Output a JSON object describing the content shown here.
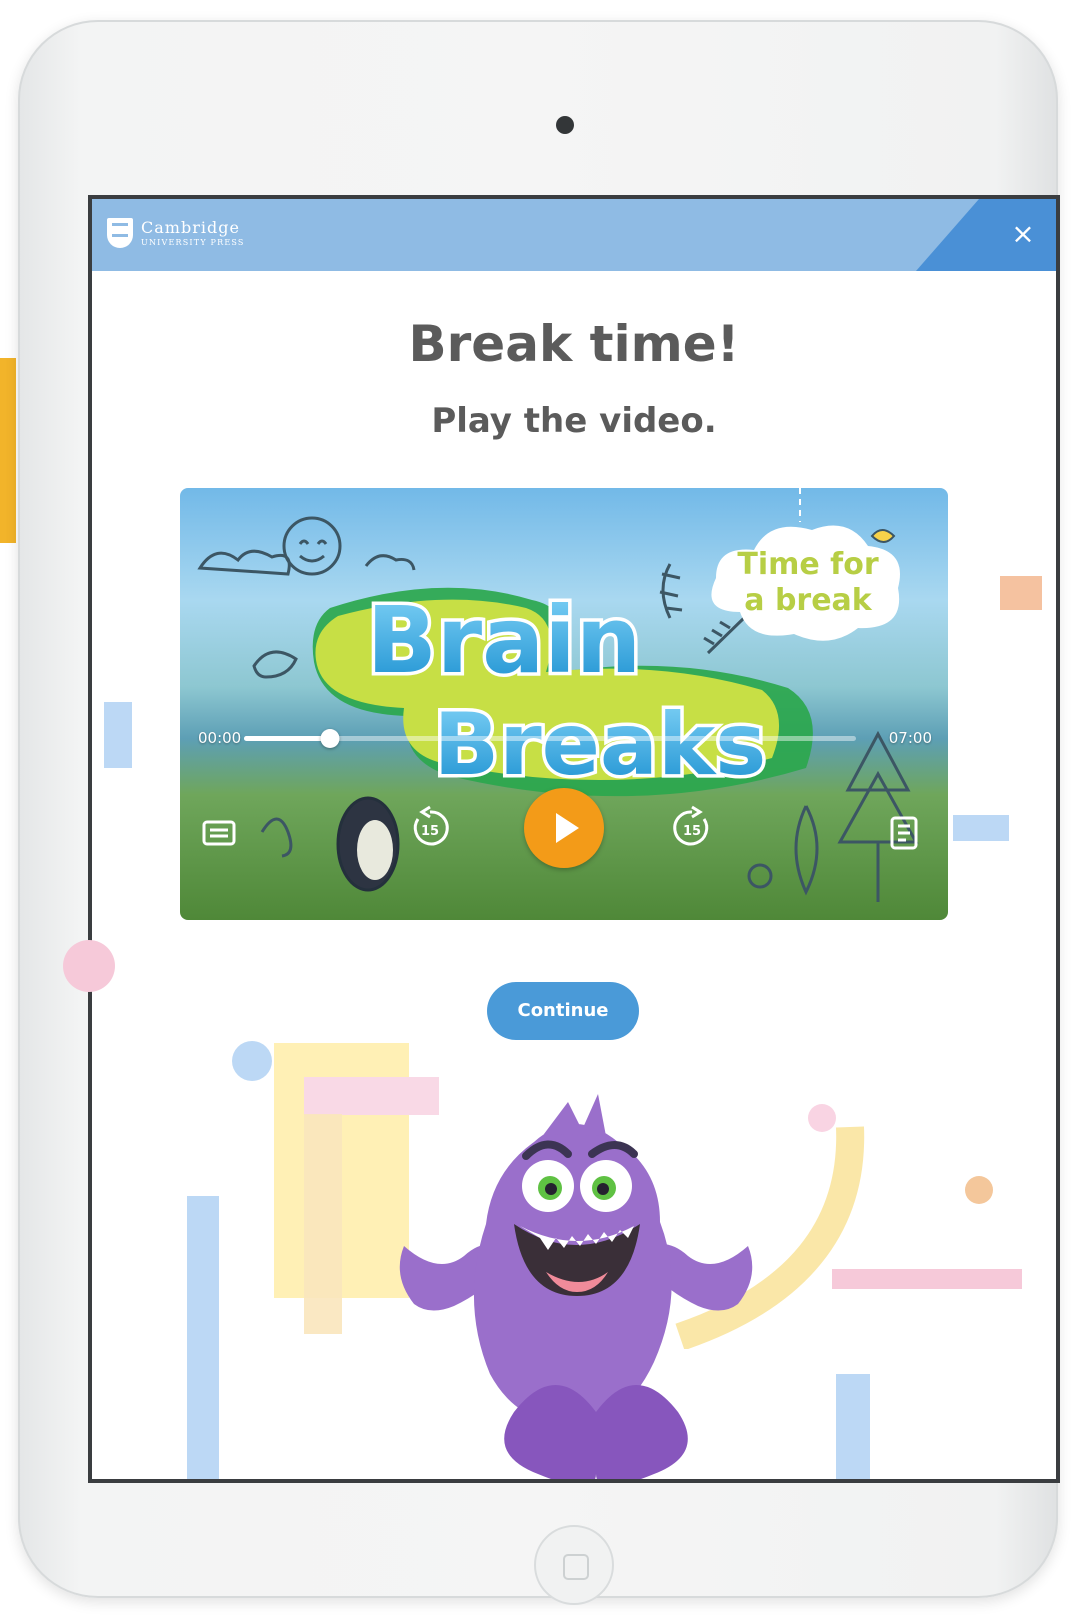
{
  "brand": {
    "name_line1": "Cambridge",
    "name_line2": "UNIVERSITY PRESS"
  },
  "header": {
    "close_label": "×"
  },
  "content": {
    "title": "Break time!",
    "subtitle": "Play the video."
  },
  "video": {
    "poster_title_line1": "Brain",
    "poster_title_line2": "Breaks",
    "cloud_text_line1": "Time for",
    "cloud_text_line2": "a break",
    "current_time": "00:00",
    "duration": "07:00",
    "progress": 0.14,
    "rewind_seconds": "15",
    "forward_seconds": "15",
    "icons": {
      "captions": "captions-icon",
      "rewind": "rewind-15-icon",
      "play": "play-icon",
      "forward": "forward-15-icon",
      "transcript": "transcript-icon"
    },
    "play_color": "#f39b18"
  },
  "actions": {
    "continue_label": "Continue"
  },
  "colors": {
    "header": "#8fbbe4",
    "header_accent": "#4a90d6",
    "button": "#4a9ad8",
    "title_text": "#5b5b5b",
    "monster": "#9a6fcb"
  }
}
